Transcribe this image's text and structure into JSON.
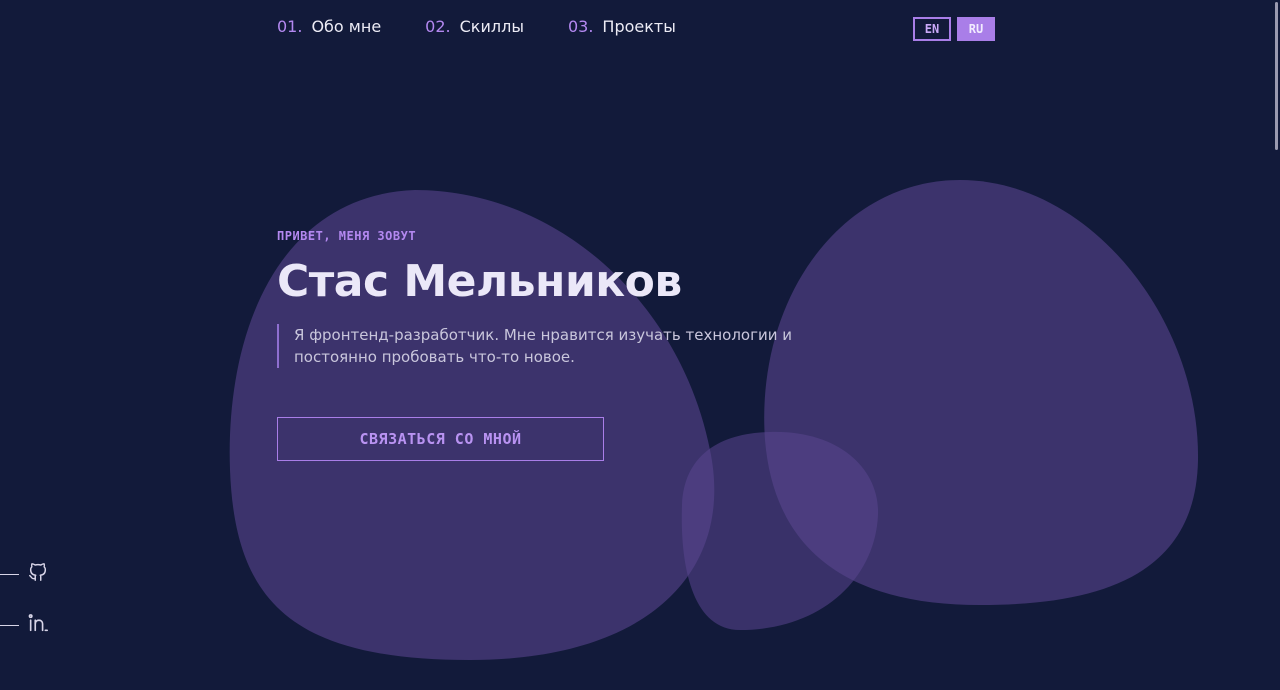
{
  "nav": {
    "items": [
      {
        "num": "01.",
        "label": "Обо мне"
      },
      {
        "num": "02.",
        "label": "Скиллы"
      },
      {
        "num": "03.",
        "label": "Проекты"
      }
    ]
  },
  "language": {
    "options": [
      "EN",
      "RU"
    ],
    "active": "RU"
  },
  "hero": {
    "greeting": "ПРИВЕТ, МЕНЯ ЗОВУТ",
    "name": "Стас Мельников",
    "about": "Я фронтенд-разработчик. Мне нравится изучать технологии и постоянно пробовать что-то новое.",
    "cta_label": "СВЯЗАТЬСЯ СО МНОЙ"
  },
  "social": [
    {
      "icon": "github-icon"
    },
    {
      "icon": "linkedin-icon"
    }
  ],
  "colors": {
    "background": "#121a3a",
    "accent": "#a97ee8",
    "blob": "#4a3a78"
  }
}
